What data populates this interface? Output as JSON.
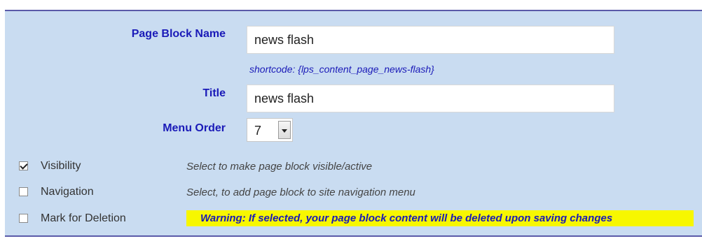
{
  "form": {
    "page_block_name_label": "Page Block Name",
    "page_block_name_value": "news flash",
    "shortcode_text": "shortcode: {lps_content_page_news-flash}",
    "title_label": "Title",
    "title_value": "news flash",
    "menu_order_label": "Menu Order",
    "menu_order_value": "7"
  },
  "options": {
    "visibility": {
      "label": "Visibility",
      "checked": true,
      "description": "Select to make page block visible/active"
    },
    "navigation": {
      "label": "Navigation",
      "checked": false,
      "description": "Select, to add page block to site navigation menu"
    },
    "deletion": {
      "label": "Mark for Deletion",
      "checked": false,
      "warning": "Warning: If selected, your page block content will be deleted upon saving changes"
    }
  },
  "colors": {
    "panel_bg": "#c9dcf1",
    "label_blue": "#1a1ab8",
    "warning_bg": "#f7f700",
    "border": "#5a5aa8"
  }
}
